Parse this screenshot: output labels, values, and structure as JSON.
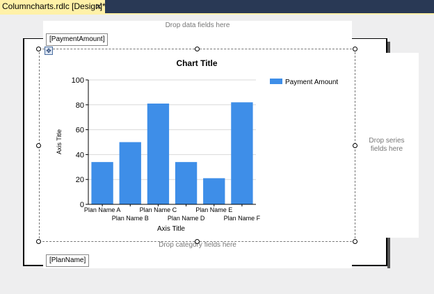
{
  "tab": {
    "label": "Columncharts.rdlc [Design]*",
    "close_icon": "close-icon"
  },
  "report": {
    "data_zone_text": "Drop data fields here",
    "data_field": "[PaymentAmount]",
    "series_zone_text": "Drop series fields here",
    "category_zone_text": "Drop category fields here",
    "category_field": "[PlanName]"
  },
  "colors": {
    "bar": "#3e8ee8",
    "tab_bar": "#293955",
    "active_tab": "#fff1a8"
  },
  "chart_data": {
    "type": "bar",
    "title": "Chart Title",
    "xlabel": "Axis Title",
    "ylabel": "Axis Title",
    "categories": [
      "Plan Name A",
      "Plan Name B",
      "Plan Name C",
      "Plan Name D",
      "Plan Name E",
      "Plan Name F"
    ],
    "series": [
      {
        "name": "Payment Amount",
        "values": [
          34,
          50,
          81,
          34,
          21,
          82
        ]
      }
    ],
    "ylim": [
      0,
      100
    ],
    "yticks": [
      0,
      20,
      40,
      60,
      80,
      100
    ],
    "grid": true,
    "legend": "top-right"
  }
}
